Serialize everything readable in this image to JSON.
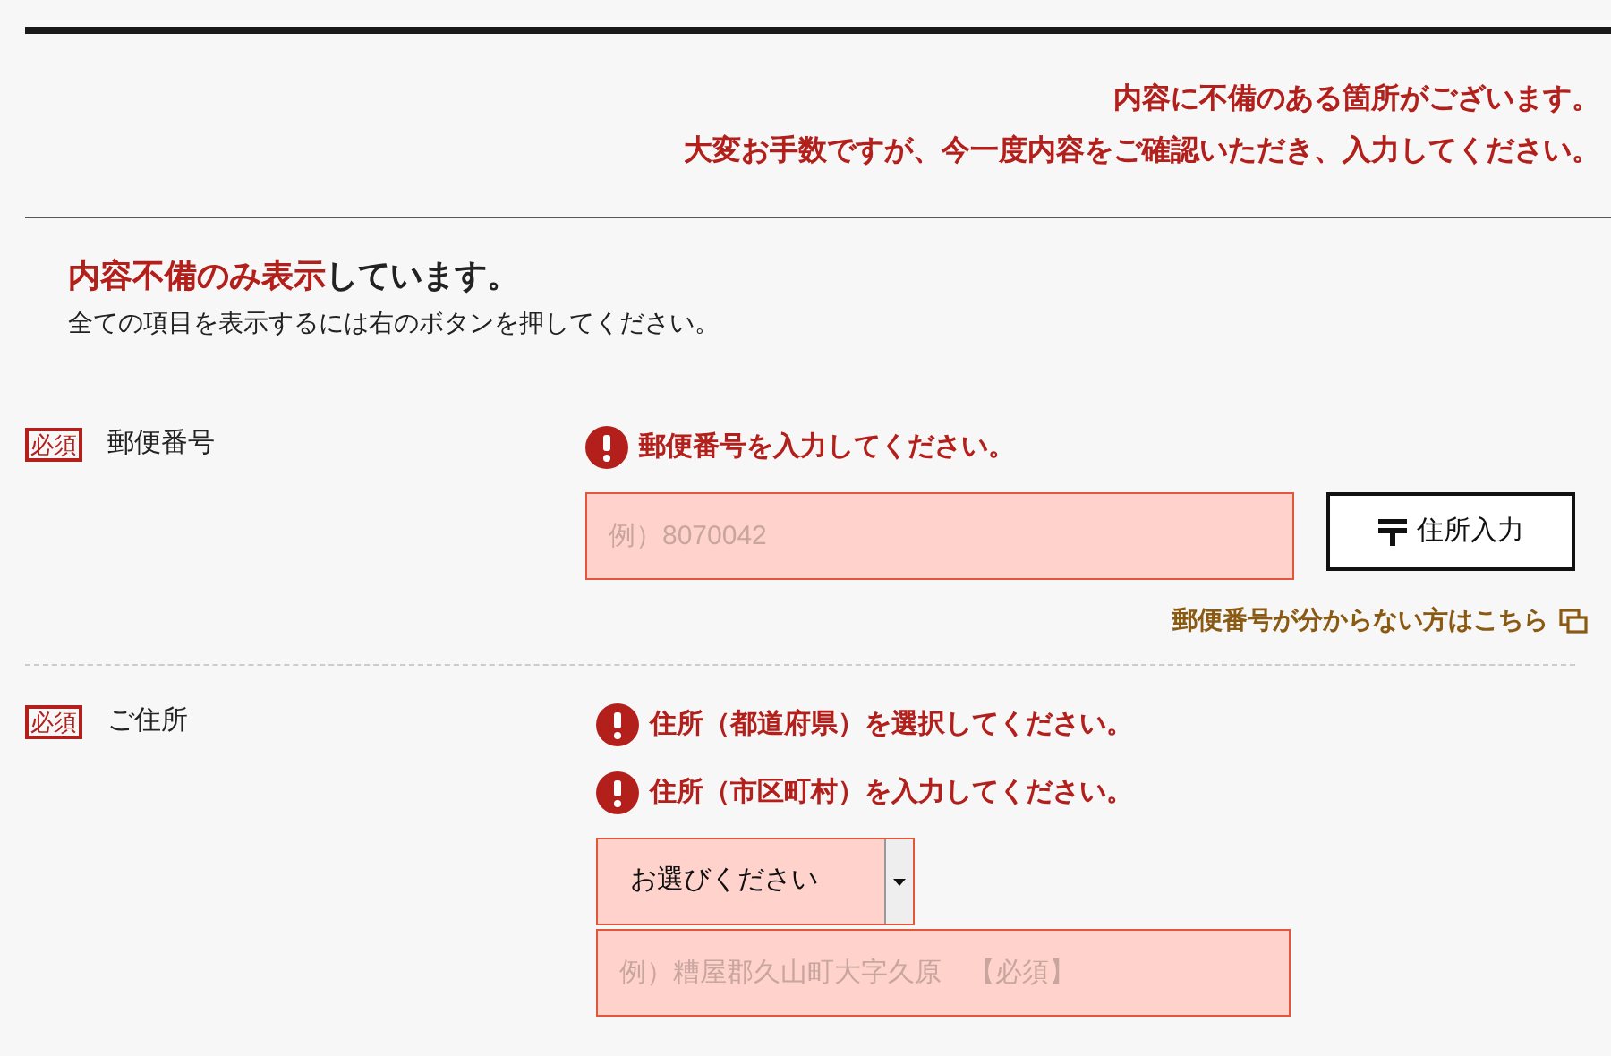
{
  "alert": {
    "lines": [
      "内容に不備のある箇所がございます。",
      "大変お手数ですが、今一度内容をご確認いただき、入力してください。"
    ]
  },
  "filter_notice": {
    "highlight": "内容不備のみ表示",
    "rest": "しています。",
    "hint": "全ての項目を表示するには右のボタンを押してください。"
  },
  "fields": [
    {
      "kind": "postcode",
      "badge": "必須",
      "label": "郵便番号",
      "errors": [
        "郵便番号を入力してください。"
      ],
      "input": {
        "placeholder": "例）8070042",
        "invalid": true
      },
      "button": "住所入力",
      "link": "郵便番号が分からない方はこちら"
    },
    {
      "kind": "address",
      "badge": "必須",
      "label": "ご住所",
      "errors": [
        "住所（都道府県）を選択してください。",
        "住所（市区町村）を入力してください。"
      ],
      "select": {
        "value": "お選びください",
        "invalid": true
      },
      "input": {
        "placeholder": "例）糟屋郡久山町大字久原　【必須】",
        "invalid": true
      }
    }
  ]
}
